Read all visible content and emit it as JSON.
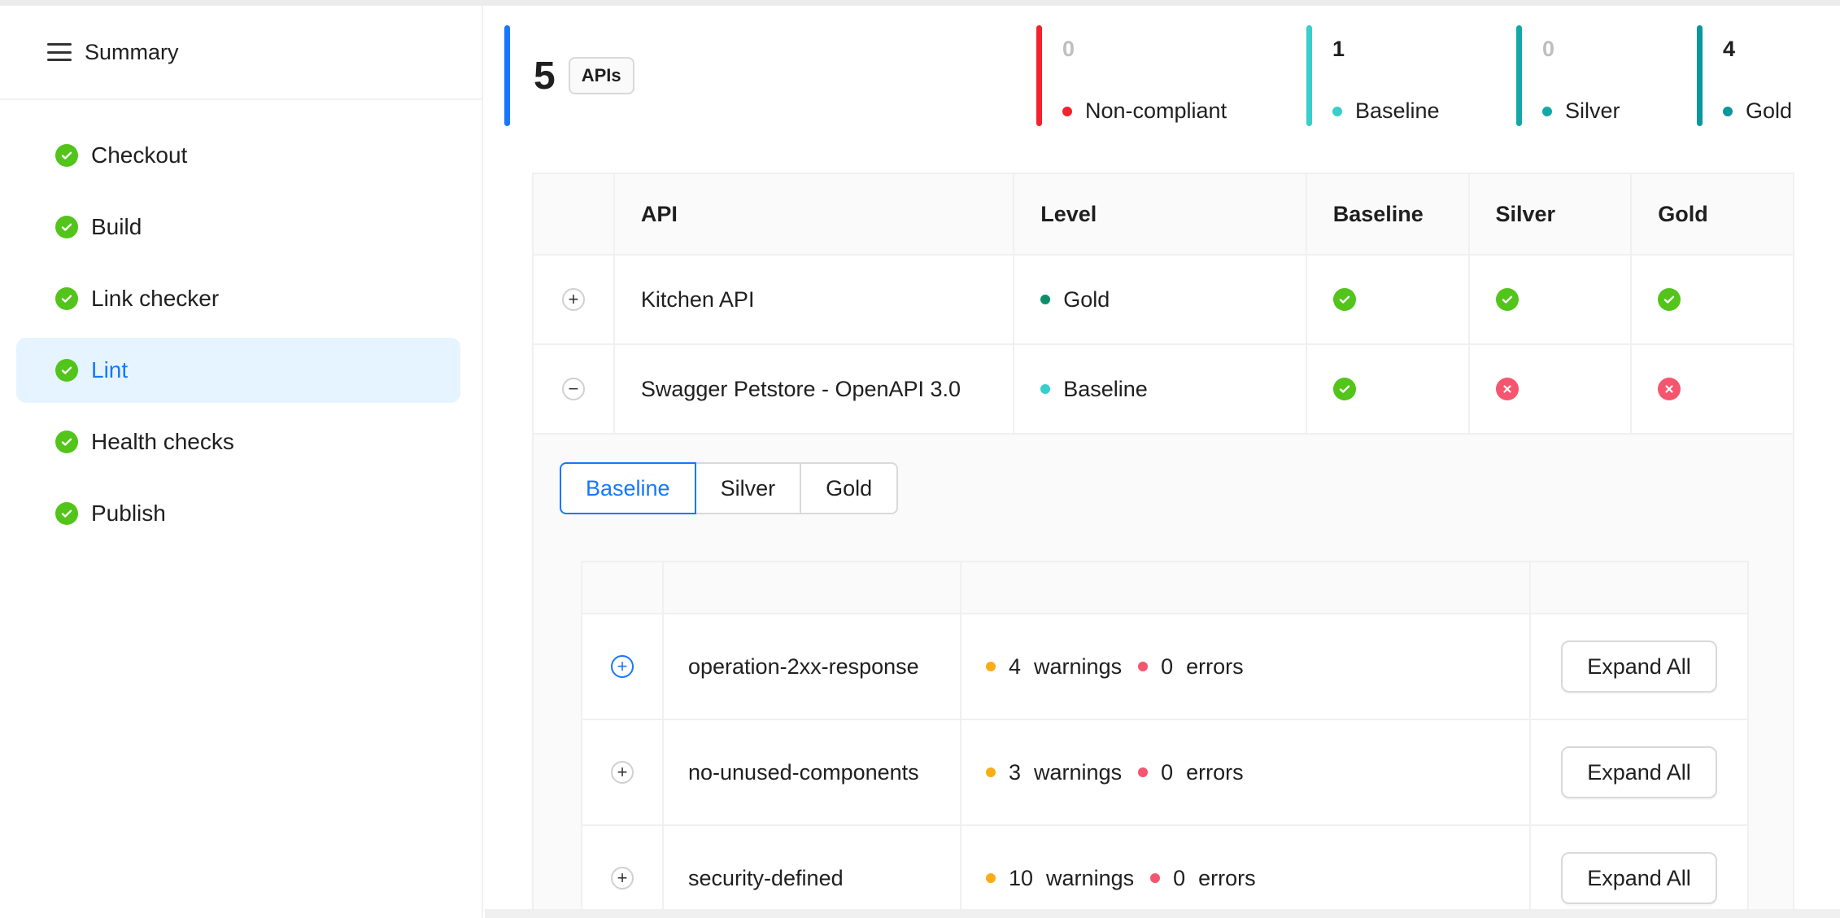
{
  "sidebar": {
    "title": "Summary",
    "items": [
      {
        "label": "Checkout"
      },
      {
        "label": "Build"
      },
      {
        "label": "Link checker"
      },
      {
        "label": "Lint",
        "active": true
      },
      {
        "label": "Health checks"
      },
      {
        "label": "Publish"
      }
    ]
  },
  "summary": {
    "total": "5",
    "total_tag": "APIs",
    "levels": [
      {
        "count": "0",
        "label": "Non-compliant",
        "color": "#f5222d"
      },
      {
        "count": "1",
        "label": "Baseline",
        "color": "#36cfc9"
      },
      {
        "count": "0",
        "label": "Silver",
        "color": "#13a8a8"
      },
      {
        "count": "4",
        "label": "Gold",
        "color": "#08979c"
      }
    ]
  },
  "table": {
    "headers": [
      "API",
      "Level",
      "Baseline",
      "Silver",
      "Gold"
    ],
    "rows": [
      {
        "expander": "+",
        "api": "Kitchen API",
        "level": "Gold",
        "level_color": "#0e8f6b",
        "baseline": "pass",
        "silver": "pass",
        "gold": "pass"
      },
      {
        "expander": "−",
        "api": "Swagger Petstore - OpenAPI 3.0",
        "level": "Baseline",
        "level_color": "#36cfc9",
        "baseline": "pass",
        "silver": "fail",
        "gold": "fail"
      }
    ]
  },
  "expanded": {
    "tabs": [
      "Baseline",
      "Silver",
      "Gold"
    ],
    "selected_tab": "Baseline",
    "rules": [
      {
        "name": "operation-2xx-response",
        "warnings": "4",
        "errors": "0"
      },
      {
        "name": "no-unused-components",
        "warnings": "3",
        "errors": "0"
      },
      {
        "name": "security-defined",
        "warnings": "10",
        "errors": "0"
      }
    ],
    "warnings_label": "warnings",
    "errors_label": "errors",
    "expand_label": "Expand All",
    "warning_color": "#faad14",
    "error_color": "#f5556e"
  }
}
